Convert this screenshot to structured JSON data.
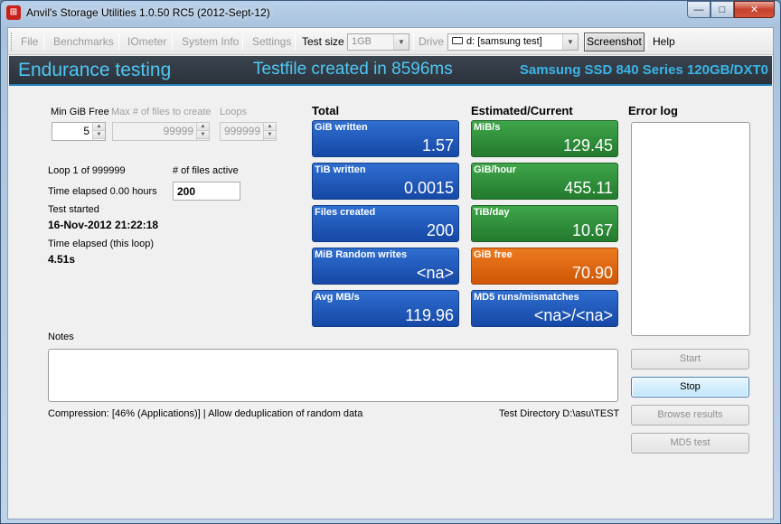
{
  "window": {
    "title": "Anvil's Storage Utilities 1.0.50 RC5 (2012-Sept-12)",
    "app_icon_glyph": "⊞",
    "controls": {
      "minimize": "—",
      "maximize": "□",
      "close": "✕"
    }
  },
  "menu": {
    "file": "File",
    "benchmarks": "Benchmarks",
    "iometer": "IOmeter",
    "system_info": "System Info",
    "settings": "Settings",
    "test_size_label": "Test size",
    "test_size_value": "1GB",
    "drive_label": "Drive",
    "drive_value": "d: [samsung test]",
    "screenshot": "Screenshot",
    "help": "Help",
    "dropdown_glyph": "▼"
  },
  "header": {
    "title": "Endurance testing",
    "status": "Testfile created in 8596ms",
    "drive": "Samsung SSD 840 Series 120GB/DXT0"
  },
  "params": {
    "min_gib_free_label": "Min GiB Free",
    "min_gib_free_value": "5",
    "max_files_label": "Max # of files to create",
    "max_files_value": "99999",
    "loops_label": "Loops",
    "loops_value": "999999",
    "spin_up": "▲",
    "spin_down": "▼"
  },
  "progress": {
    "loop": "Loop 1 of 999999",
    "files_active_label": "# of files active",
    "files_active_value": "200",
    "time_elapsed": "Time elapsed 0.00 hours",
    "test_started_label": "Test started",
    "test_started_value": "16-Nov-2012 21:22:18",
    "loop_elapsed_label": "Time elapsed (this loop)",
    "loop_elapsed_value": "4.51s"
  },
  "totals": {
    "heading": "Total",
    "tiles": [
      {
        "label": "GiB written",
        "value": "1.57"
      },
      {
        "label": "TiB written",
        "value": "0.0015"
      },
      {
        "label": "Files created",
        "value": "200"
      },
      {
        "label": "MiB Random writes",
        "value": "<na>"
      },
      {
        "label": "Avg MB/s",
        "value": "119.96"
      }
    ]
  },
  "current": {
    "heading": "Estimated/Current",
    "tiles": [
      {
        "label": "MiB/s",
        "value": "129.45"
      },
      {
        "label": "GiB/hour",
        "value": "455.11"
      },
      {
        "label": "TiB/day",
        "value": "10.67"
      },
      {
        "label": "GiB free",
        "value": "70.90"
      },
      {
        "label": "MD5 runs/mismatches",
        "value": "<na>/<na>"
      }
    ]
  },
  "error_log": {
    "heading": "Error log"
  },
  "notes": {
    "label": "Notes"
  },
  "footer": {
    "compression": "Compression: [46% (Applications)] | Allow deduplication of random data",
    "test_directory": "Test Directory D:\\asu\\TEST"
  },
  "actions": {
    "start": "Start",
    "stop": "Stop",
    "browse": "Browse results",
    "md5": "MD5 test"
  },
  "colors": {
    "tile_blue": "#1c55b8",
    "tile_green": "#2f8f3a",
    "tile_orange": "#df6610",
    "header_text": "#4fc6f4"
  }
}
